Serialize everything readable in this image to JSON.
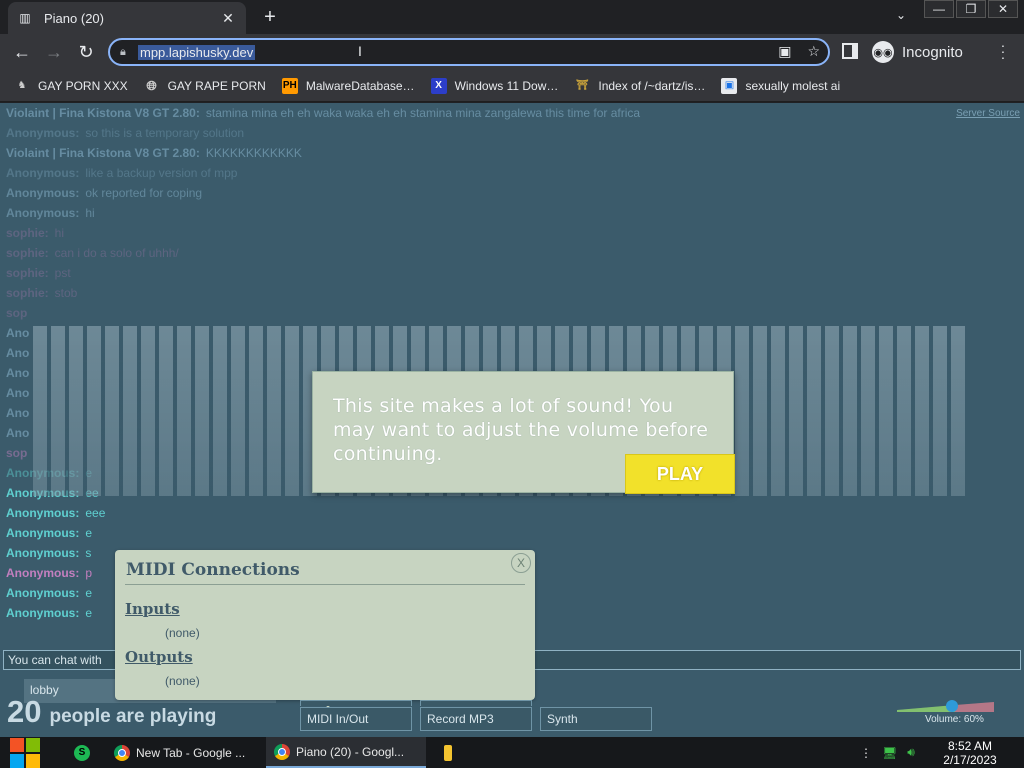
{
  "browser": {
    "tab_title": "Piano (20)",
    "tab_close": "✕",
    "new_tab": "+",
    "url": "mpp.lapishusky.dev",
    "profile_label": "Incognito",
    "bookmarks": [
      {
        "label": "GAY PORN XXX",
        "icon": "wolf-icon"
      },
      {
        "label": "GAY RAPE PORN",
        "icon": "globe-icon"
      },
      {
        "label": "MalwareDatabase…",
        "icon": "PH"
      },
      {
        "label": "Windows 11 Dow…",
        "icon": "X"
      },
      {
        "label": "Index of /~dartz/is…",
        "icon": "shrine-icon"
      },
      {
        "label": "sexually molest ai",
        "icon": "image-icon"
      }
    ]
  },
  "page": {
    "server_source": "Server Source",
    "chat": [
      {
        "nick": "Violaint | Fina Kistona V8 GT 2.80:",
        "text": "stamina mina eh eh waka waka eh eh stamina mina zangalewa this time for africa",
        "color": "#9bc9e3",
        "style": "mid"
      },
      {
        "nick": "Anonymous:",
        "text": "so this is a temporary solution",
        "color": "#9bc9e3",
        "style": "faint"
      },
      {
        "nick": "Violaint | Fina Kistona V8 GT 2.80:",
        "text": "KKKKKKKKKKKK",
        "color": "#9bc9e3",
        "style": "mid"
      },
      {
        "nick": "Anonymous:",
        "text": "like a backup version of mpp",
        "color": "#9bc9e3",
        "style": "faint"
      },
      {
        "nick": "Anonymous:",
        "text": "ok reported for coping",
        "color": "#8fbcd4",
        "style": "mid"
      },
      {
        "nick": "Anonymous:",
        "text": "hi",
        "color": "#8fbcd4",
        "style": "mid"
      },
      {
        "nick": "sophie:",
        "text": "hi",
        "color": "#c37fbf",
        "style": "faint"
      },
      {
        "nick": "sophie:",
        "text": "can i do a solo of uhhh/",
        "color": "#c37fbf",
        "style": "faint"
      },
      {
        "nick": "sophie:",
        "text": "pst",
        "color": "#c37fbf",
        "style": "faint"
      },
      {
        "nick": "sophie:",
        "text": "stob",
        "color": "#c37fbf",
        "style": "faint"
      },
      {
        "nick": "sop",
        "text": "",
        "color": "#c37fbf",
        "style": "faint"
      },
      {
        "nick": "Ano",
        "text": "",
        "color": "#9bc9e3",
        "style": "mid"
      },
      {
        "nick": "Ano",
        "text": "",
        "color": "#9bc9e3",
        "style": "mid"
      },
      {
        "nick": "Ano",
        "text": "",
        "color": "#9bc9e3",
        "style": "mid"
      },
      {
        "nick": "Ano",
        "text": "",
        "color": "#9bc9e3",
        "style": "mid"
      },
      {
        "nick": "Ano",
        "text": "",
        "color": "#9bc9e3",
        "style": "mid"
      },
      {
        "nick": "Ano",
        "text": "",
        "color": "#9bc9e3",
        "style": "mid"
      },
      {
        "nick": "sop",
        "text": "",
        "color": "#c37fbf",
        "style": "mid"
      },
      {
        "nick": "Anonymous:",
        "text": "e",
        "color": "#5fd0d0",
        "style": "mid"
      },
      {
        "nick": "Anonymous:",
        "text": "ee",
        "color": "#5fd0d0",
        "style": "full"
      },
      {
        "nick": "Anonymous:",
        "text": "eee",
        "color": "#5fd0d0",
        "style": "full"
      },
      {
        "nick": "Anonymous:",
        "text": "e",
        "color": "#5fd0d0",
        "style": "full"
      },
      {
        "nick": "Anonymous:",
        "text": "s",
        "color": "#5fd0d0",
        "style": "full"
      },
      {
        "nick": "Anonymous:",
        "text": "p",
        "color": "#c37fbf",
        "style": "full"
      },
      {
        "nick": "Anonymous:",
        "text": "e",
        "color": "#5fd0d0",
        "style": "full"
      },
      {
        "nick": "Anonymous:",
        "text": "e",
        "color": "#5fd0d0",
        "style": "full"
      }
    ],
    "notice": {
      "text": "This site makes a lot of sound! You may want to adjust the volume before continuing.",
      "play_label": "PLAY"
    },
    "chat_input_placeholder": "You can chat with",
    "room_name": "lobby",
    "midi": {
      "title": "MIDI Connections",
      "close": "X",
      "inputs_label": "Inputs",
      "inputs_value": "(none)",
      "outputs_label": "Outputs",
      "outputs_value": "(none)"
    },
    "player_count": "20",
    "player_label": "people are playing",
    "buttons": {
      "midi": "MIDI In/Out",
      "record": "Record MP3",
      "synth": "Synth"
    },
    "volume": {
      "label": "Volume: 60%",
      "value": 0.6
    }
  },
  "taskbar": {
    "apps": [
      {
        "label": "New Tab - Google ...",
        "icon": "chrome-icon"
      },
      {
        "label": "Piano (20) - Googl...",
        "icon": "chrome-icon"
      }
    ],
    "time": "8:52 AM",
    "date": "2/17/2023"
  },
  "colors": {
    "page_bg": "#3b5b6b",
    "panel_bg": "#c7d4c1",
    "play_button": "#f2e12a",
    "omnibox_focus": "#8ab4f8"
  }
}
